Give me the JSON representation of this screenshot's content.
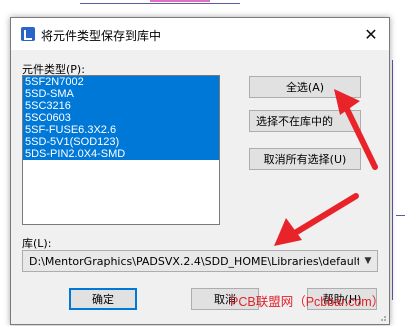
{
  "dialog": {
    "title": "将元件类型保存到库中",
    "list_label": "元件类型(P):",
    "items": [
      "5SF2N7002",
      "5SD-SMA",
      "5SC3216",
      "5SC0603",
      "5SF-FUSE6.3X2.6",
      "5SD-5V1(SOD123)",
      "5DS-PIN2.0X4-SMD"
    ],
    "buttons": {
      "select_all": "全选(A)",
      "select_not_in_library": "选择不在库中的",
      "deselect_all": "取消所有选择(U)",
      "ok": "确定",
      "cancel": "取消",
      "help": "帮助(H)"
    },
    "library_label": "库(L):",
    "library_value": "D:\\MentorGraphics\\PADSVX.2.4\\SDD_HOME\\Libraries\\default"
  },
  "watermark": "PCB联盟网（Pcbbar.com）",
  "colors": {
    "selection": "#0078d7",
    "annotation_arrow": "#e8232a"
  }
}
